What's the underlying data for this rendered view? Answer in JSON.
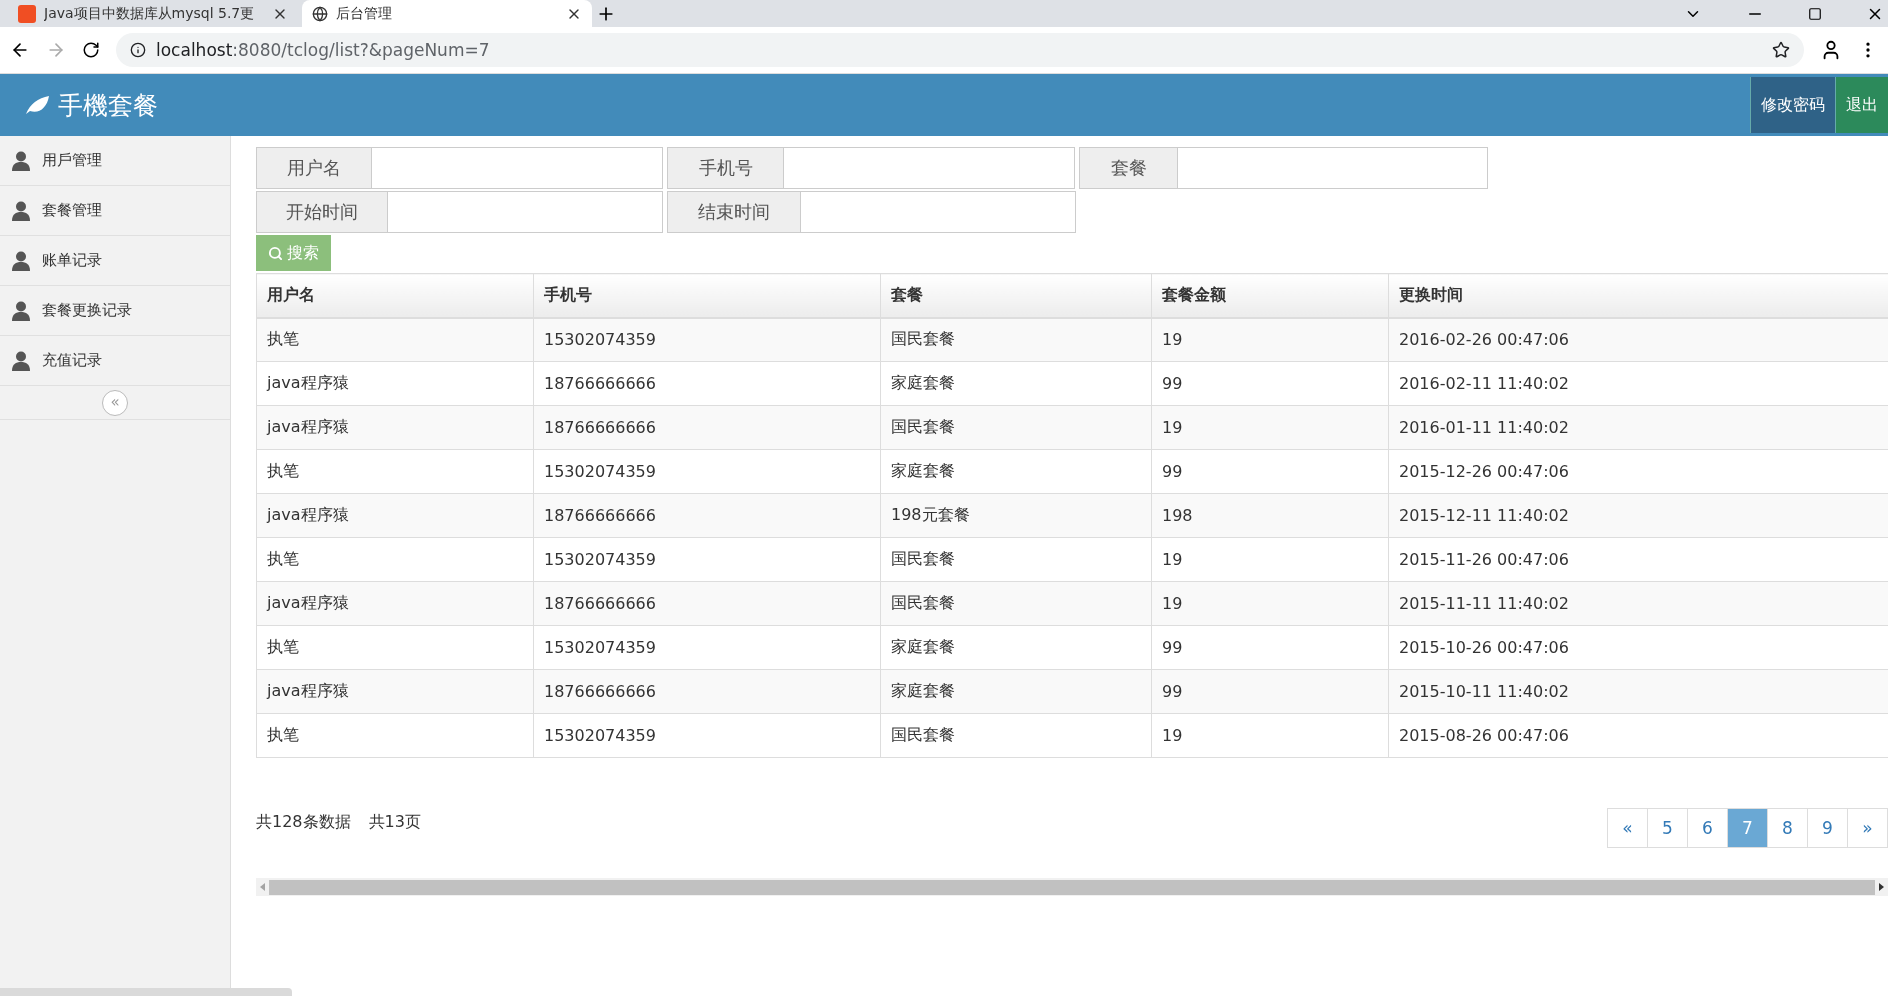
{
  "browser": {
    "tabs": [
      {
        "title": "Java项目中数据库从mysql 5.7更",
        "selected": false
      },
      {
        "title": "后台管理",
        "selected": true
      }
    ],
    "url_host": "localhost",
    "url_rest": ":8080/tclog/list?&pageNum=7"
  },
  "header": {
    "brand": "手機套餐",
    "buttons": [
      {
        "label": "修改密码",
        "kind": "primary"
      },
      {
        "label": "退出",
        "kind": "success"
      }
    ]
  },
  "sidebar": {
    "items": [
      {
        "label": "用戶管理"
      },
      {
        "label": "套餐管理"
      },
      {
        "label": "账单记录"
      },
      {
        "label": "套餐更换记录"
      },
      {
        "label": "充值记录"
      }
    ],
    "collapse": "«"
  },
  "search_form": {
    "rows": [
      [
        {
          "label": "用户名"
        },
        {
          "label": "手机号"
        },
        {
          "label": "套餐"
        }
      ],
      [
        {
          "label": "开始时间"
        },
        {
          "label": "结束时间"
        }
      ]
    ],
    "button": "搜索"
  },
  "table": {
    "columns": [
      "用户名",
      "手机号",
      "套餐",
      "套餐金额",
      "更换时间"
    ],
    "rows": [
      [
        "执笔",
        "15302074359",
        "国民套餐",
        "19",
        "2016-02-26 00:47:06"
      ],
      [
        "java程序猿",
        "18766666666",
        "家庭套餐",
        "99",
        "2016-02-11 11:40:02"
      ],
      [
        "java程序猿",
        "18766666666",
        "国民套餐",
        "19",
        "2016-01-11 11:40:02"
      ],
      [
        "执笔",
        "15302074359",
        "家庭套餐",
        "99",
        "2015-12-26 00:47:06"
      ],
      [
        "java程序猿",
        "18766666666",
        "198元套餐",
        "198",
        "2015-12-11 11:40:02"
      ],
      [
        "执笔",
        "15302074359",
        "国民套餐",
        "19",
        "2015-11-26 00:47:06"
      ],
      [
        "java程序猿",
        "18766666666",
        "国民套餐",
        "19",
        "2015-11-11 11:40:02"
      ],
      [
        "执笔",
        "15302074359",
        "家庭套餐",
        "99",
        "2015-10-26 00:47:06"
      ],
      [
        "java程序猿",
        "18766666666",
        "家庭套餐",
        "99",
        "2015-10-11 11:40:02"
      ],
      [
        "执笔",
        "15302074359",
        "国民套餐",
        "19",
        "2015-08-26 00:47:06"
      ]
    ]
  },
  "pagination": {
    "total_records": "共128条数据",
    "total_pages": "共13页",
    "prev": "«",
    "next": "»",
    "pages": [
      {
        "label": "5",
        "selected": false
      },
      {
        "label": "6",
        "selected": false
      },
      {
        "label": "7",
        "selected": true
      },
      {
        "label": "8",
        "selected": false
      },
      {
        "label": "9",
        "selected": false
      }
    ]
  }
}
